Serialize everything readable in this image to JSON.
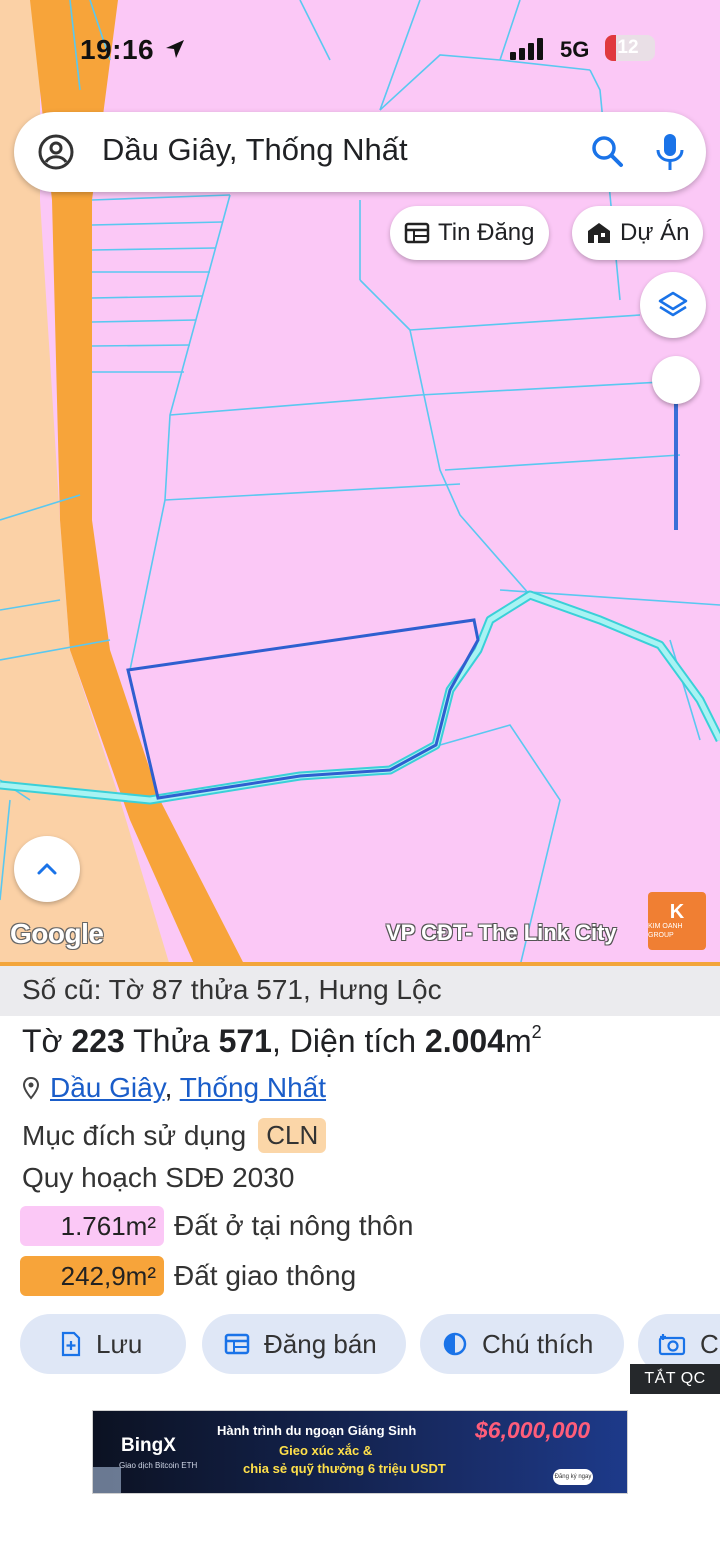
{
  "status_bar": {
    "time": "19:16",
    "network": "5G",
    "battery": "12"
  },
  "search": {
    "query": "Dầu Giây, Thống Nhất"
  },
  "map_chips": {
    "listings": "Tin Đăng",
    "projects": "Dự Án"
  },
  "map": {
    "google_logo": "Google",
    "watermark": "VP CĐT- The Link City",
    "sponsor_logo": "K",
    "sponsor_name": "KIM OANH GROUP"
  },
  "parcel": {
    "old_ref": "Số cũ: Tờ 87 thửa 571, Hưng Lộc",
    "sheet_label": "Tờ",
    "sheet_no": "223",
    "plot_label": "Thửa",
    "plot_no": "571",
    "area_label": ", Diện tích",
    "area_value": "2.004",
    "area_unit": "m",
    "area_sup": "2",
    "district": "Dầu Giây",
    "separator": ",",
    "commune": "Thống Nhất",
    "purpose_label": "Mục đích sử dụng",
    "purpose_code": "CLN",
    "plan_label": "Quy hoạch SDĐ 2030",
    "zones": [
      {
        "area": "1.761m²",
        "label": "Đất ở tại nông thôn",
        "color": "#fbc8f6"
      },
      {
        "area": "242,9m²",
        "label": "Đất giao thông",
        "color": "#f7a43a"
      }
    ]
  },
  "actions": {
    "save": "Lưu",
    "sell": "Đăng bán",
    "legend": "Chú thích",
    "camera": "C"
  },
  "ad_toggle": "TẮT QC",
  "ad": {
    "brand": "BingX",
    "brand_sub": "Giao dịch Bitcoin ETH",
    "line1": "Hành trình du ngoạn Giáng Sinh",
    "line2": "Gieo xúc xắc &",
    "line3": "chia sẻ quỹ thưởng 6 triệu USDT",
    "amount": "$6,000,000",
    "cta": "Đăng ký ngay"
  },
  "colors": {
    "residential": "#fbc8f6",
    "road": "#f7a43a",
    "boundary": "#3a6fd8",
    "accent": "#1a5dc9"
  }
}
